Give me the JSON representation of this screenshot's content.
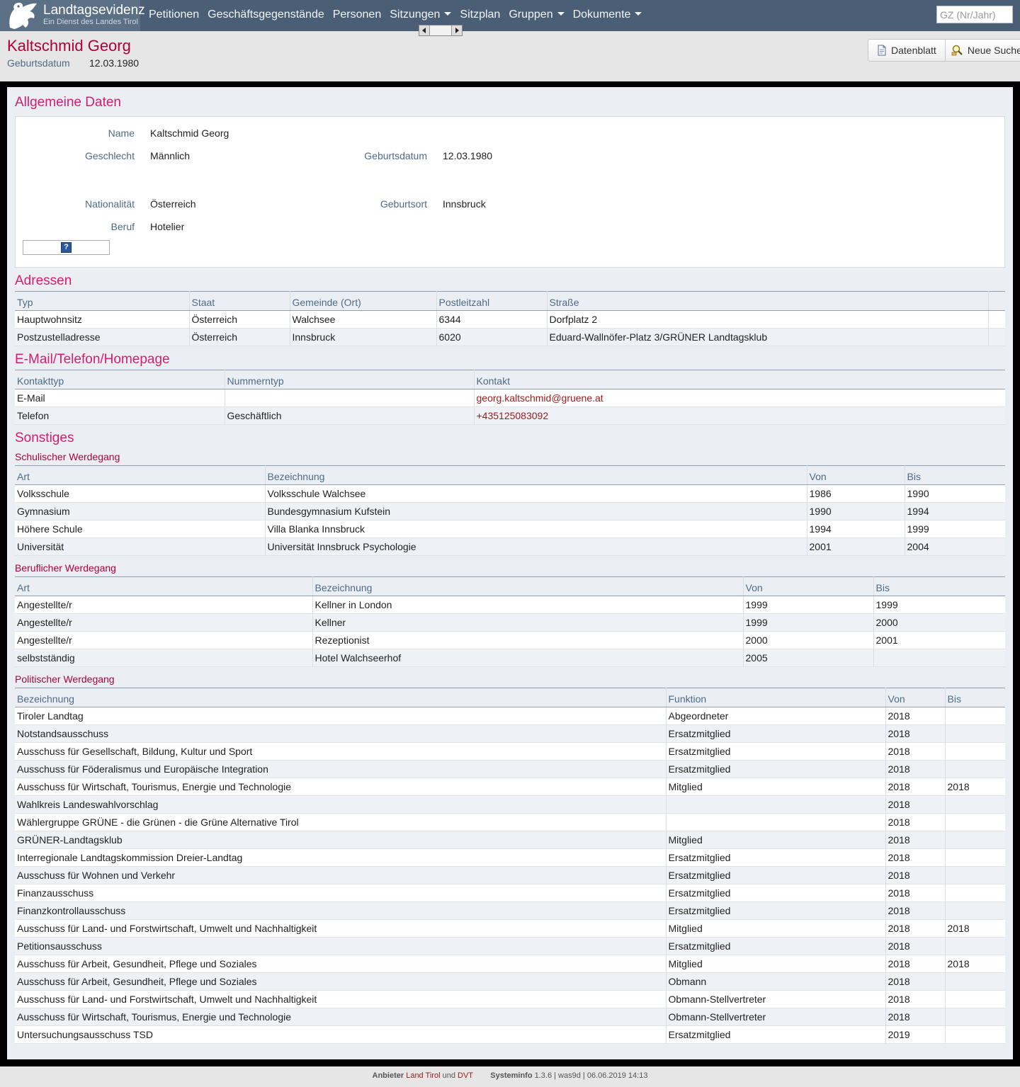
{
  "nav": {
    "brand_title": "Landtagsevidenz",
    "brand_sub": "Ein Dienst des Landes Tirol",
    "items": [
      {
        "label": "Petitionen",
        "dropdown": false
      },
      {
        "label": "Geschäftsgegenstände",
        "dropdown": false
      },
      {
        "label": "Personen",
        "dropdown": false
      },
      {
        "label": "Sitzungen",
        "dropdown": true
      },
      {
        "label": "Sitzplan",
        "dropdown": false
      },
      {
        "label": "Gruppen",
        "dropdown": true
      },
      {
        "label": "Dokumente",
        "dropdown": true
      }
    ],
    "search_placeholder": "GZ (Nr/Jahr)"
  },
  "header": {
    "title": "Kaltschmid Georg",
    "dob_label": "Geburtsdatum",
    "dob_value": "12.03.1980",
    "buttons": {
      "datenblatt": "Datenblatt",
      "neue_suche": "Neue Suche"
    }
  },
  "general": {
    "title": "Allgemeine Daten",
    "name_label": "Name",
    "name": "Kaltschmid Georg",
    "gender_label": "Geschlecht",
    "gender": "Männlich",
    "dob_label": "Geburtsdatum",
    "dob": "12.03.1980",
    "nationality_label": "Nationalität",
    "nationality": "Österreich",
    "birthplace_label": "Geburtsort",
    "birthplace": "Innsbruck",
    "job_label": "Beruf",
    "job": "Hotelier",
    "help_glyph": "?"
  },
  "addresses": {
    "title": "Adressen",
    "headers": [
      "Typ",
      "Staat",
      "Gemeinde (Ort)",
      "Postleitzahl",
      "Straße",
      ""
    ],
    "rows": [
      [
        "Hauptwohnsitz",
        "Österreich",
        "Walchsee",
        "6344",
        "Dorfplatz 2",
        ""
      ],
      [
        "Postzustelladresse",
        "Österreich",
        "Innsbruck",
        "6020",
        "Eduard-Wallnöfer-Platz 3/GRÜNER Landtagsklub",
        ""
      ]
    ]
  },
  "contact": {
    "title": "E-Mail/Telefon/Homepage",
    "headers": [
      "Kontakttyp",
      "Nummerntyp",
      "Kontakt"
    ],
    "rows": [
      [
        "E-Mail",
        "",
        "georg.kaltschmid@gruene.at"
      ],
      [
        "Telefon",
        "Geschäftlich",
        "+435125083092"
      ]
    ]
  },
  "misc": {
    "title": "Sonstiges",
    "school": {
      "title": "Schulischer Werdegang",
      "headers": [
        "Art",
        "Bezeichnung",
        "Von",
        "Bis"
      ],
      "rows": [
        [
          "Volksschule",
          "Volksschule Walchsee",
          "1986",
          "1990"
        ],
        [
          "Gymnasium",
          "Bundesgymnasium Kufstein",
          "1990",
          "1994"
        ],
        [
          "Höhere Schule",
          "Villa Blanka Innsbruck",
          "1994",
          "1999"
        ],
        [
          "Universität",
          "Universität Innsbruck Psychologie",
          "2001",
          "2004"
        ]
      ]
    },
    "career": {
      "title": "Beruflicher Werdegang",
      "headers": [
        "Art",
        "Bezeichnung",
        "Von",
        "Bis"
      ],
      "rows": [
        [
          "Angestellte/r",
          "Kellner in London",
          "1999",
          "1999"
        ],
        [
          "Angestellte/r",
          "Kellner",
          "1999",
          "2000"
        ],
        [
          "Angestellte/r",
          "Rezeptionist",
          "2000",
          "2001"
        ],
        [
          "selbstständig",
          "Hotel Walchseerhof",
          "2005",
          ""
        ]
      ]
    },
    "politics": {
      "title": "Politischer Werdegang",
      "headers": [
        "Bezeichnung",
        "Funktion",
        "Von",
        "Bis"
      ],
      "rows": [
        [
          "Tiroler Landtag",
          "Abgeordneter",
          "2018",
          ""
        ],
        [
          "Notstandsausschuss",
          "Ersatzmitglied",
          "2018",
          ""
        ],
        [
          "Ausschuss für Gesellschaft, Bildung, Kultur und Sport",
          "Ersatzmitglied",
          "2018",
          ""
        ],
        [
          "Ausschuss für Föderalismus und Europäische Integration",
          "Ersatzmitglied",
          "2018",
          ""
        ],
        [
          "Ausschuss für Wirtschaft, Tourismus, Energie und Technologie",
          "Mitglied",
          "2018",
          "2018"
        ],
        [
          "Wahlkreis Landeswahlvorschlag",
          "",
          "2018",
          ""
        ],
        [
          "Wählergruppe GRÜNE - die Grünen - die Grüne Alternative Tirol",
          "",
          "2018",
          ""
        ],
        [
          "GRÜNER-Landtagsklub",
          "Mitglied",
          "2018",
          ""
        ],
        [
          "Interregionale Landtagskommission Dreier-Landtag",
          "Ersatzmitglied",
          "2018",
          ""
        ],
        [
          "Ausschuss für Wohnen und Verkehr",
          "Ersatzmitglied",
          "2018",
          ""
        ],
        [
          "Finanzausschuss",
          "Ersatzmitglied",
          "2018",
          ""
        ],
        [
          "Finanzkontrollausschuss",
          "Ersatzmitglied",
          "2018",
          ""
        ],
        [
          "Ausschuss für Land- und Forstwirtschaft, Umwelt und Nachhaltigkeit",
          "Mitglied",
          "2018",
          "2018"
        ],
        [
          "Petitionsausschuss",
          "Ersatzmitglied",
          "2018",
          ""
        ],
        [
          "Ausschuss für Arbeit, Gesundheit, Pflege und Soziales",
          "Mitglied",
          "2018",
          "2018"
        ],
        [
          "Ausschuss für Arbeit, Gesundheit, Pflege und Soziales",
          "Obmann",
          "2018",
          ""
        ],
        [
          "Ausschuss für Land- und Forstwirtschaft, Umwelt und Nachhaltigkeit",
          "Obmann-Stellvertreter",
          "2018",
          ""
        ],
        [
          "Ausschuss für Wirtschaft, Tourismus, Energie und Technologie",
          "Obmann-Stellvertreter",
          "2018",
          ""
        ],
        [
          "Untersuchungsausschuss TSD",
          "Ersatzmitglied",
          "2019",
          ""
        ]
      ]
    }
  },
  "footer": {
    "provider_label": "Anbieter",
    "provider_1": "Land Tirol",
    "and": "und",
    "provider_2": "DVT",
    "sysinfo_label": "Systeminfo",
    "sysinfo": "1.3.6 | was9d | 06.06.2019 14:13"
  },
  "colors": {
    "nav_bg": "#4a5f76",
    "title_red": "#b0003a",
    "section_pink": "#d41e6b",
    "label_blue": "#4f6a87",
    "link_red": "#9b1a1a"
  }
}
